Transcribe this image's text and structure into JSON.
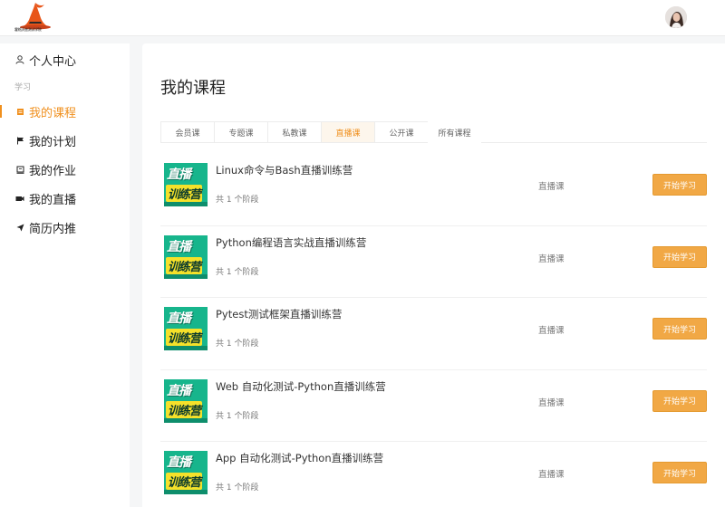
{
  "header": {
    "logo_text": "霍格沃兹测试学院",
    "avatar_icon": "user-avatar"
  },
  "sidebar": {
    "top_item": {
      "label": "个人中心",
      "icon": "user-icon"
    },
    "group_label": "学习",
    "items": [
      {
        "label": "我的课程",
        "icon": "book-icon",
        "active": true
      },
      {
        "label": "我的计划",
        "icon": "flag-icon",
        "active": false
      },
      {
        "label": "我的作业",
        "icon": "homework-icon",
        "active": false
      },
      {
        "label": "我的直播",
        "icon": "live-icon",
        "active": false
      },
      {
        "label": "简历内推",
        "icon": "send-icon",
        "active": false
      }
    ]
  },
  "main": {
    "title": "我的课程",
    "tabs": [
      {
        "label": "会员课",
        "active": false
      },
      {
        "label": "专题课",
        "active": false
      },
      {
        "label": "私教课",
        "active": false
      },
      {
        "label": "直播课",
        "active": true
      },
      {
        "label": "公开课",
        "active": false
      },
      {
        "label": "所有课程",
        "active": false
      }
    ],
    "thumb_text_1": "直播",
    "thumb_text_2": "训练营",
    "courses": [
      {
        "title": "Linux命令与Bash直播训练营",
        "stages": "共 1 个阶段",
        "type": "直播课",
        "button": "开始学习"
      },
      {
        "title": "Python编程语言实战直播训练营",
        "stages": "共 1 个阶段",
        "type": "直播课",
        "button": "开始学习"
      },
      {
        "title": "Pytest测试框架直播训练营",
        "stages": "共 1 个阶段",
        "type": "直播课",
        "button": "开始学习"
      },
      {
        "title": "Web 自动化测试-Python直播训练营",
        "stages": "共 1 个阶段",
        "type": "直播课",
        "button": "开始学习"
      },
      {
        "title": "App 自动化测试-Python直播训练营",
        "stages": "共 1 个阶段",
        "type": "直播课",
        "button": "开始学习"
      }
    ]
  },
  "colors": {
    "accent": "#f0901e",
    "button": "#f1a845",
    "thumb_bg": "#17b58c"
  }
}
